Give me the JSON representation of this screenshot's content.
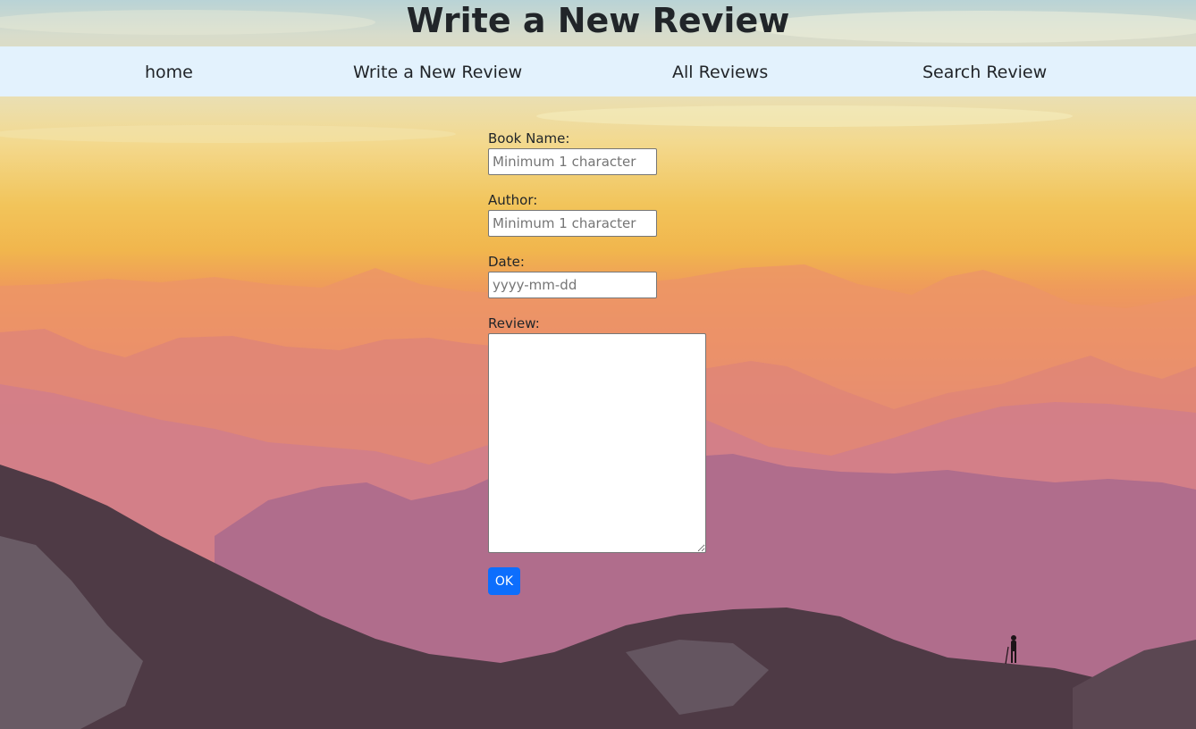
{
  "page": {
    "title": "Write a New Review"
  },
  "nav": {
    "items": [
      {
        "label": "home"
      },
      {
        "label": "Write a New Review"
      },
      {
        "label": "All Reviews"
      },
      {
        "label": "Search Review"
      }
    ]
  },
  "form": {
    "book_name": {
      "label": "Book Name:",
      "value": "",
      "placeholder": "Minimum 1 character"
    },
    "author": {
      "label": "Author:",
      "value": "",
      "placeholder": "Minimum 1 character"
    },
    "date": {
      "label": "Date:",
      "value": "",
      "placeholder": "yyyy-mm-dd"
    },
    "review": {
      "label": "Review:",
      "value": ""
    },
    "submit_label": "OK"
  },
  "colors": {
    "navbar_bg": "#e3f2fd",
    "button_bg": "#0d6efd",
    "text": "#212529"
  }
}
